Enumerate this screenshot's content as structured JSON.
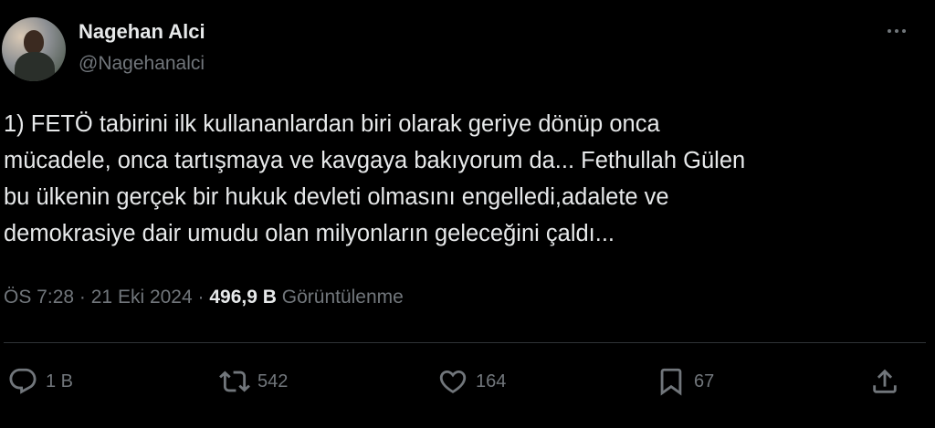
{
  "author": {
    "name": "Nagehan Alci",
    "handle": "@Nagehanalci"
  },
  "tweet": {
    "text": "1) FETÖ tabirini ilk kullananlardan biri olarak geriye dönüp onca\nmücadele, onca tartışmaya ve kavgaya bakıyorum da... Fethullah Gülen\nbu ülkenin gerçek bir hukuk devleti olmasını engelledi,adalete ve\ndemokrasiye dair umudu olan milyonların geleceğini çaldı...",
    "time": "ÖS 7:28",
    "separator": "·",
    "date": "21 Eki 2024",
    "views_count": "496,9 B",
    "views_label": "Görüntülenme"
  },
  "actions": {
    "replies": "1 B",
    "retweets": "542",
    "likes": "164",
    "bookmarks": "67"
  },
  "icons": {
    "menu": "more-icon",
    "reply": "reply-icon",
    "retweet": "retweet-icon",
    "like": "heart-icon",
    "bookmark": "bookmark-icon",
    "share": "share-icon"
  },
  "colors": {
    "background": "#000000",
    "text": "#e7e9ea",
    "secondary": "#71767b",
    "divider": "#2f3336"
  }
}
